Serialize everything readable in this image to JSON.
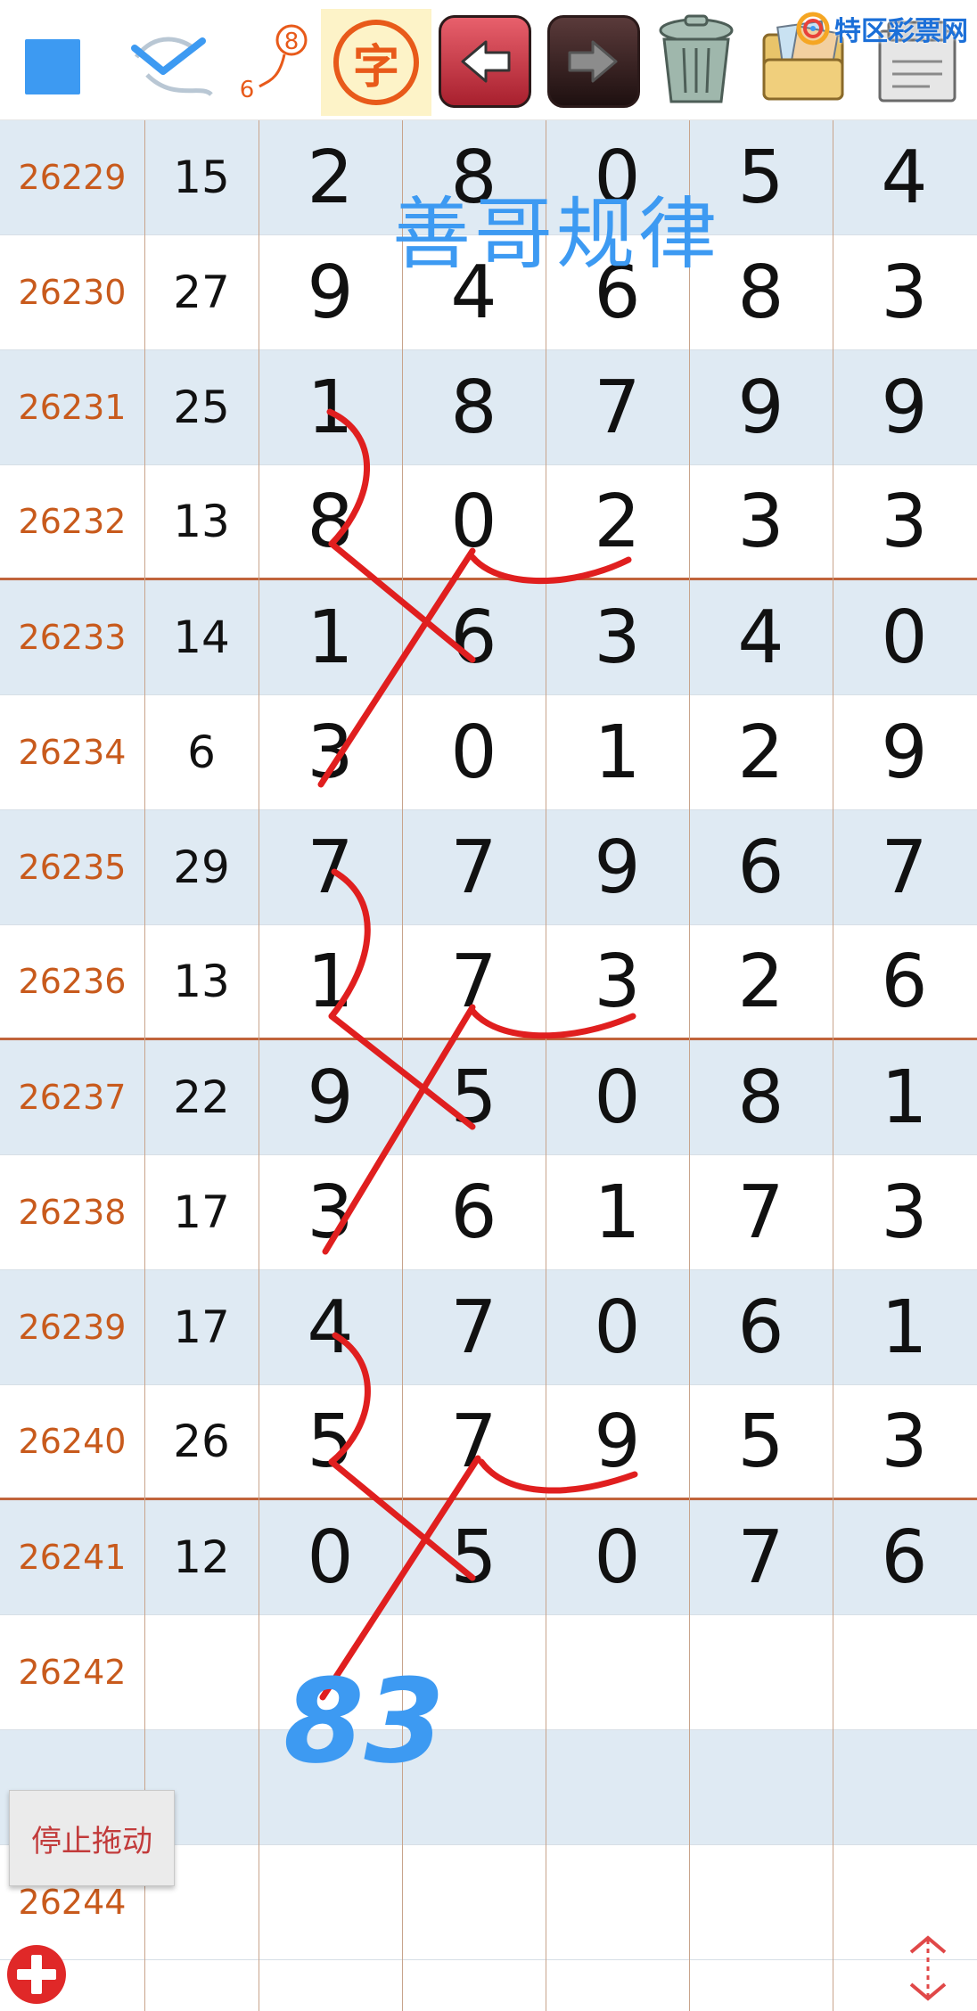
{
  "toolbar": {
    "colors": {
      "swatch": "#3d9af2",
      "accent": "#e85a1a",
      "back": "#c0303c",
      "forward": "#2a1818"
    },
    "sequence_labels": {
      "first": "6",
      "second": "8"
    },
    "char_button_label": "字",
    "icons": [
      "color-swatch-icon",
      "pen-check-icon",
      "sequence-icon",
      "text-icon",
      "back-arrow-icon",
      "forward-arrow-icon",
      "trash-icon",
      "folder-icon",
      "note-icon"
    ]
  },
  "site_logo": {
    "text": "特区彩票网"
  },
  "title_overlay": "善哥规律",
  "rows": [
    {
      "period": "26229",
      "sum": "15",
      "digits": [
        "2",
        "8",
        "0",
        "5",
        "4"
      ]
    },
    {
      "period": "26230",
      "sum": "27",
      "digits": [
        "9",
        "4",
        "6",
        "8",
        "3"
      ]
    },
    {
      "period": "26231",
      "sum": "25",
      "digits": [
        "1",
        "8",
        "7",
        "9",
        "9"
      ]
    },
    {
      "period": "26232",
      "sum": "13",
      "digits": [
        "8",
        "0",
        "2",
        "3",
        "3"
      ]
    },
    {
      "period": "26233",
      "sum": "14",
      "digits": [
        "1",
        "6",
        "3",
        "4",
        "0"
      ]
    },
    {
      "period": "26234",
      "sum": "6",
      "digits": [
        "3",
        "0",
        "1",
        "2",
        "9"
      ]
    },
    {
      "period": "26235",
      "sum": "29",
      "digits": [
        "7",
        "7",
        "9",
        "6",
        "7"
      ]
    },
    {
      "period": "26236",
      "sum": "13",
      "digits": [
        "1",
        "7",
        "3",
        "2",
        "6"
      ]
    },
    {
      "period": "26237",
      "sum": "22",
      "digits": [
        "9",
        "5",
        "0",
        "8",
        "1"
      ]
    },
    {
      "period": "26238",
      "sum": "17",
      "digits": [
        "3",
        "6",
        "1",
        "7",
        "3"
      ]
    },
    {
      "period": "26239",
      "sum": "17",
      "digits": [
        "4",
        "7",
        "0",
        "6",
        "1"
      ]
    },
    {
      "period": "26240",
      "sum": "26",
      "digits": [
        "5",
        "7",
        "9",
        "5",
        "3"
      ]
    },
    {
      "period": "26241",
      "sum": "12",
      "digits": [
        "0",
        "5",
        "0",
        "7",
        "6"
      ]
    },
    {
      "period": "26242",
      "sum": "",
      "digits": [
        "",
        "",
        "",
        "",
        ""
      ]
    },
    {
      "period": "",
      "sum": "",
      "digits": [
        "",
        "",
        "",
        "",
        ""
      ]
    },
    {
      "period": "26244",
      "sum": "",
      "digits": [
        "",
        "",
        "",
        "",
        ""
      ]
    }
  ],
  "group_end_rows": [
    3,
    7,
    11
  ],
  "handwriting": {
    "prediction": "83",
    "stroke_color": "#e01f1f",
    "prediction_color": "#3d9af2"
  },
  "buttons": {
    "stop_drag": "停止拖动"
  }
}
